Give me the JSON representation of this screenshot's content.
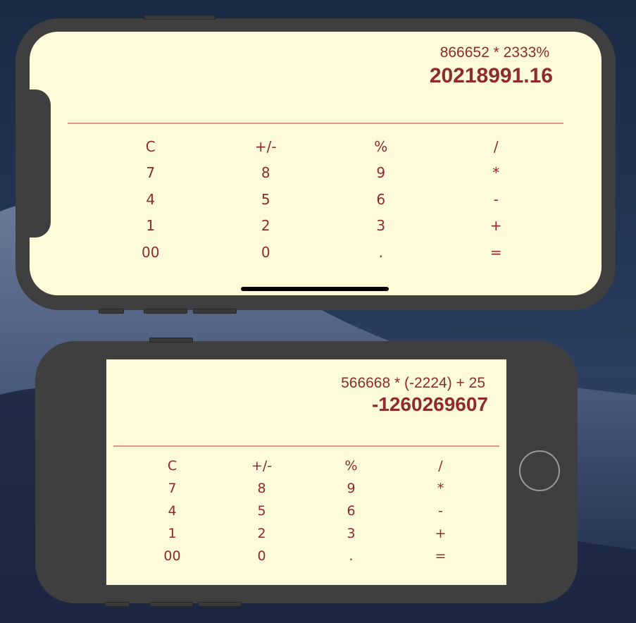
{
  "colors": {
    "screen_background": "#fdfbd8",
    "text": "#8e2a30",
    "divider": "#e0968a",
    "device_body": "#3f3f3f",
    "desktop_background": "#243656"
  },
  "phone_x": {
    "expression": "866652 * 2333%",
    "result": "20218991.16",
    "keys": [
      "C",
      "+/-",
      "%",
      "/",
      "7",
      "8",
      "9",
      "*",
      "4",
      "5",
      "6",
      "-",
      "1",
      "2",
      "3",
      "+",
      "00",
      "0",
      ".",
      "="
    ]
  },
  "phone_8": {
    "expression": "566668 * (-2224) + 25",
    "result": "-1260269607",
    "keys": [
      "C",
      "+/-",
      "%",
      "/",
      "7",
      "8",
      "9",
      "*",
      "4",
      "5",
      "6",
      "-",
      "1",
      "2",
      "3",
      "+",
      "00",
      "0",
      ".",
      "="
    ]
  }
}
